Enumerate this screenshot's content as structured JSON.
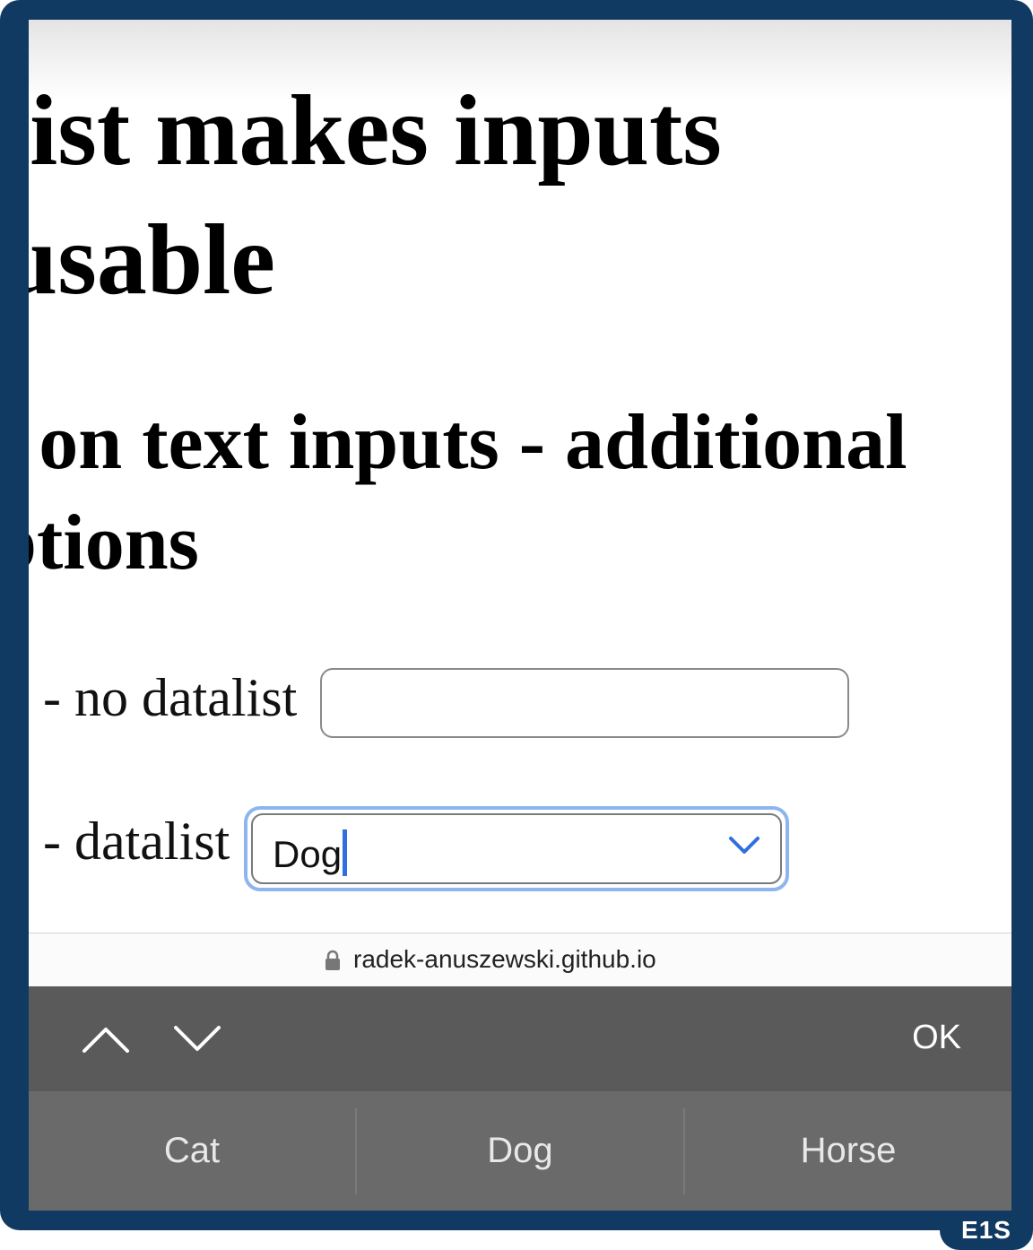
{
  "page": {
    "heading1_line1": "list makes inputs",
    "heading1_line2": " usable",
    "heading2_line1": "t on text inputs - additional",
    "heading2_line2": "ptions"
  },
  "form": {
    "no_datalist_label": "- no datalist",
    "no_datalist_value": "",
    "datalist_label": "- datalist",
    "datalist_value": "Dog"
  },
  "browser": {
    "url": "radek-anuszewski.github.io"
  },
  "keyboard_toolbar": {
    "ok_label": "OK",
    "suggestions": [
      "Cat",
      "Dog",
      "Horse"
    ]
  },
  "badge": {
    "text": "E1S"
  },
  "colors": {
    "frame": "#113a63",
    "focus_ring": "#8db6ee",
    "caret": "#2f6fe0",
    "toolbar": "#5a5a5a",
    "suggestion_bar": "#6a6a6a"
  }
}
